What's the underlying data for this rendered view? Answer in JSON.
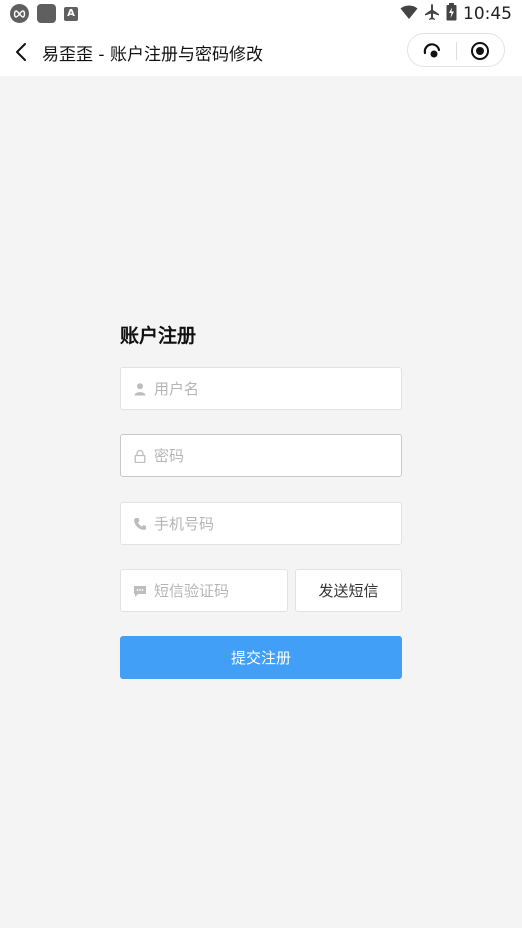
{
  "statusbar": {
    "time": "10:45",
    "icons_left": [
      "infinity-icon",
      "app-square-icon",
      "font-a-icon"
    ],
    "icons_right": [
      "wifi-icon",
      "airplane-icon",
      "battery-charging-icon"
    ]
  },
  "navbar": {
    "title": "易歪歪 - 账户注册与密码修改",
    "icons": [
      "back-chevron-icon",
      "more-dots-icon",
      "target-close-icon"
    ]
  },
  "form": {
    "title": "账户注册",
    "username_placeholder": "用户名",
    "password_placeholder": "密码",
    "phone_placeholder": "手机号码",
    "sms_placeholder": "短信验证码",
    "send_sms_label": "发送短信",
    "submit_label": "提交注册"
  },
  "colors": {
    "background": "#f4f4f4",
    "primary": "#419ff8",
    "placeholder": "#b5b5b5"
  }
}
